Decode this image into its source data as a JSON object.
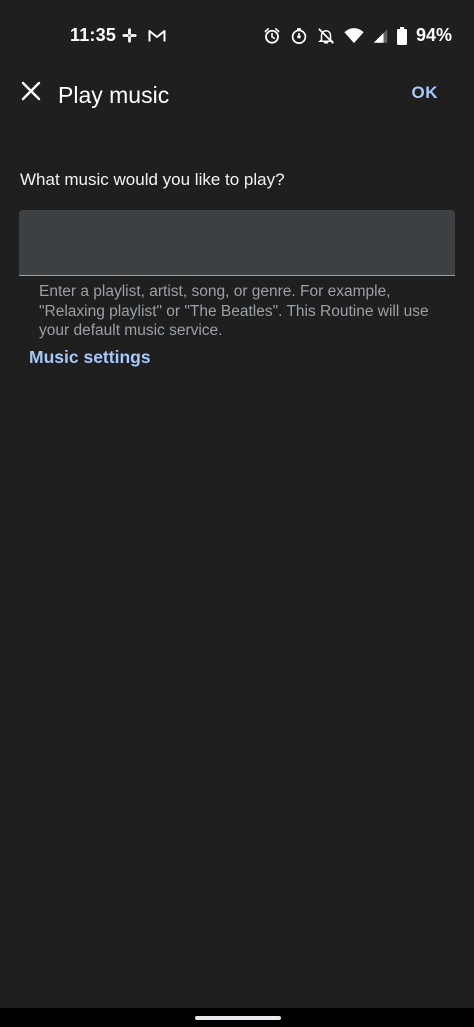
{
  "status_bar": {
    "time": "11:35",
    "battery_percent": "94%",
    "left_icons": [
      "slack-icon",
      "gmail-icon"
    ],
    "right_icons": [
      "alarm-icon",
      "timer-icon",
      "notifications-off-icon",
      "wifi-icon",
      "signal-icon",
      "battery-icon"
    ]
  },
  "app_bar": {
    "title": "Play music",
    "ok_label": "OK",
    "close_icon": "close-icon"
  },
  "form": {
    "question": "What music would you like to play?",
    "input_value": "",
    "helper_text": "Enter a playlist, artist, song, or genre. For example, \"Relaxing playlist\" or \"The Beatles\". This Routine will use your default music service.",
    "settings_link": "Music settings"
  },
  "colors": {
    "background": "#1f1f1f",
    "accent": "#a8c7fa",
    "input_fill": "#3c4043",
    "helper_text": "#9aa0a6"
  }
}
